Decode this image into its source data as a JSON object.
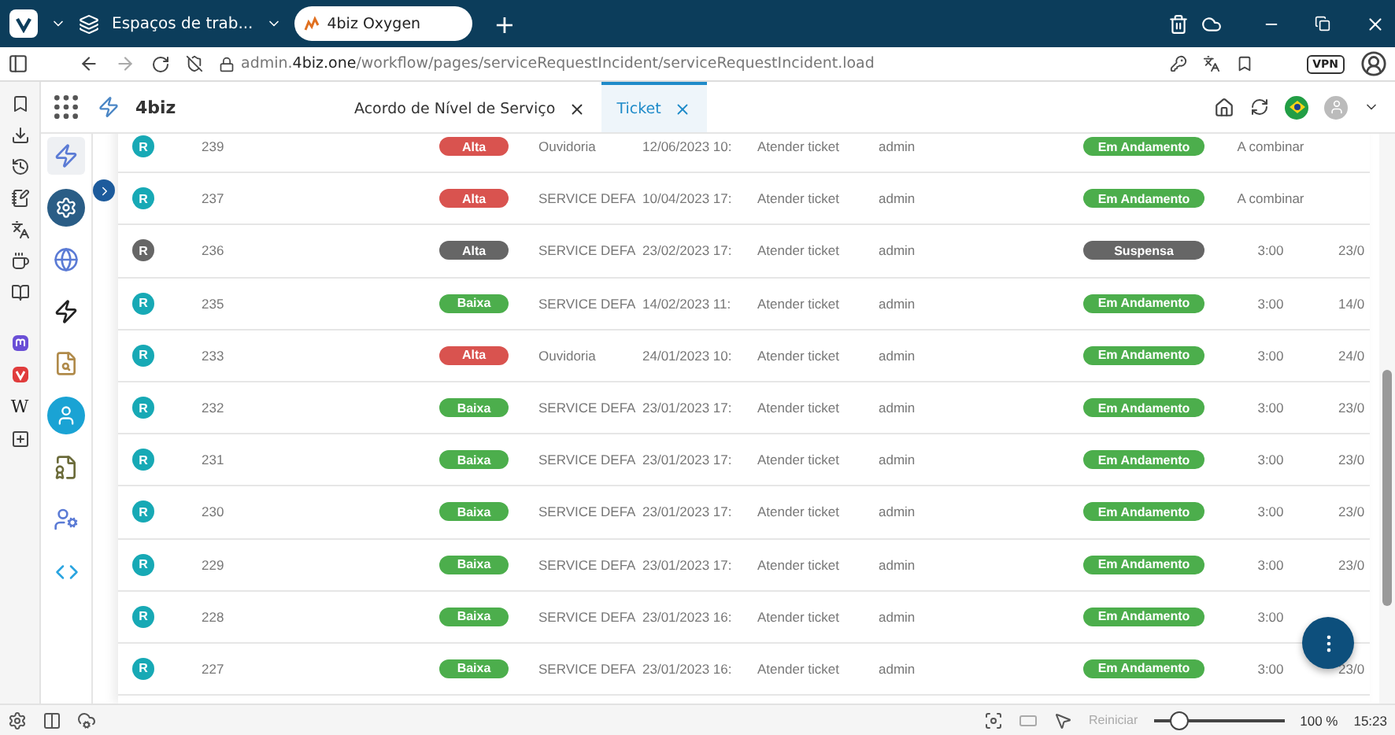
{
  "browser": {
    "workspace": "Espaços de trab...",
    "tabs": [
      {
        "title": "4biz Oxygen",
        "selected": true
      }
    ],
    "new_tab": "+",
    "url_host": "admin.",
    "url_domain": "4biz.one",
    "url_path": "/workflow/pages/serviceRequestIncident/serviceRequestIncident.load",
    "vpn": "VPN",
    "panel_wiki": "W"
  },
  "app": {
    "brand": "4biz",
    "tabs": [
      {
        "label": "Acordo de Nível de Serviço",
        "selected": false
      },
      {
        "label": "Ticket",
        "selected": true
      }
    ]
  },
  "rows": [
    {
      "icon": {
        "text": "R",
        "color": "#17a9b5"
      },
      "number": "239",
      "priority": {
        "label": "Alta",
        "color": "#d9534f"
      },
      "service": "Ouvidoria",
      "date": "12/06/2023 10:",
      "activity": "Atender ticket",
      "user": "admin",
      "status": {
        "label": "Em Andamento",
        "color": "#4cae4c"
      },
      "time": "A combinar",
      "column_10": ""
    },
    {
      "icon": {
        "text": "R",
        "color": "#17a9b5"
      },
      "number": "237",
      "priority": {
        "label": "Alta",
        "color": "#d9534f"
      },
      "service": "SERVICE DEFA",
      "date": "10/04/2023 17:",
      "activity": "Atender ticket",
      "user": "admin",
      "status": {
        "label": "Em Andamento",
        "color": "#4cae4c"
      },
      "time": "A combinar",
      "column_10": ""
    },
    {
      "icon": {
        "text": "R",
        "color": "#666666"
      },
      "number": "236",
      "priority": {
        "label": "Alta",
        "color": "#666666"
      },
      "service": "SERVICE DEFA",
      "date": "23/02/2023 17:",
      "activity": "Atender ticket",
      "user": "admin",
      "status": {
        "label": "Suspensa",
        "color": "#666666"
      },
      "time": "3:00",
      "column_10": "23/0"
    },
    {
      "icon": {
        "text": "R",
        "color": "#17a9b5"
      },
      "number": "235",
      "priority": {
        "label": "Baixa",
        "color": "#4cae4c"
      },
      "service": "SERVICE DEFA",
      "date": "14/02/2023 11:",
      "activity": "Atender ticket",
      "user": "admin",
      "status": {
        "label": "Em Andamento",
        "color": "#4cae4c"
      },
      "time": "3:00",
      "column_10": "14/0"
    },
    {
      "icon": {
        "text": "R",
        "color": "#17a9b5"
      },
      "number": "233",
      "priority": {
        "label": "Alta",
        "color": "#d9534f"
      },
      "service": "Ouvidoria",
      "date": "24/01/2023 10:",
      "activity": "Atender ticket",
      "user": "admin",
      "status": {
        "label": "Em Andamento",
        "color": "#4cae4c"
      },
      "time": "3:00",
      "column_10": "24/0"
    },
    {
      "icon": {
        "text": "R",
        "color": "#17a9b5"
      },
      "number": "232",
      "priority": {
        "label": "Baixa",
        "color": "#4cae4c"
      },
      "service": "SERVICE DEFA",
      "date": "23/01/2023 17:",
      "activity": "Atender ticket",
      "user": "admin",
      "status": {
        "label": "Em Andamento",
        "color": "#4cae4c"
      },
      "time": "3:00",
      "column_10": "23/0"
    },
    {
      "icon": {
        "text": "R",
        "color": "#17a9b5"
      },
      "number": "231",
      "priority": {
        "label": "Baixa",
        "color": "#4cae4c"
      },
      "service": "SERVICE DEFA",
      "date": "23/01/2023 17:",
      "activity": "Atender ticket",
      "user": "admin",
      "status": {
        "label": "Em Andamento",
        "color": "#4cae4c"
      },
      "time": "3:00",
      "column_10": "23/0"
    },
    {
      "icon": {
        "text": "R",
        "color": "#17a9b5"
      },
      "number": "230",
      "priority": {
        "label": "Baixa",
        "color": "#4cae4c"
      },
      "service": "SERVICE DEFA",
      "date": "23/01/2023 17:",
      "activity": "Atender ticket",
      "user": "admin",
      "status": {
        "label": "Em Andamento",
        "color": "#4cae4c"
      },
      "time": "3:00",
      "column_10": "23/0"
    },
    {
      "icon": {
        "text": "R",
        "color": "#17a9b5"
      },
      "number": "229",
      "priority": {
        "label": "Baixa",
        "color": "#4cae4c"
      },
      "service": "SERVICE DEFA",
      "date": "23/01/2023 17:",
      "activity": "Atender ticket",
      "user": "admin",
      "status": {
        "label": "Em Andamento",
        "color": "#4cae4c"
      },
      "time": "3:00",
      "column_10": "23/0"
    },
    {
      "icon": {
        "text": "R",
        "color": "#17a9b5"
      },
      "number": "228",
      "priority": {
        "label": "Baixa",
        "color": "#4cae4c"
      },
      "service": "SERVICE DEFA",
      "date": "23/01/2023 16:",
      "activity": "Atender ticket",
      "user": "admin",
      "status": {
        "label": "Em Andamento",
        "color": "#4cae4c"
      },
      "time": "3:00",
      "column_10": ""
    },
    {
      "icon": {
        "text": "R",
        "color": "#17a9b5"
      },
      "number": "227",
      "priority": {
        "label": "Baixa",
        "color": "#4cae4c"
      },
      "service": "SERVICE DEFA",
      "date": "23/01/2023 16:",
      "activity": "Atender ticket",
      "user": "admin",
      "status": {
        "label": "Em Andamento",
        "color": "#4cae4c"
      },
      "time": "3:00",
      "column_10": "23/0"
    }
  ],
  "status_bar": {
    "reset": "Reiniciar",
    "zoom": {
      "level": 0.2
    },
    "zoom_text": "100 %",
    "clock": "15:23"
  }
}
